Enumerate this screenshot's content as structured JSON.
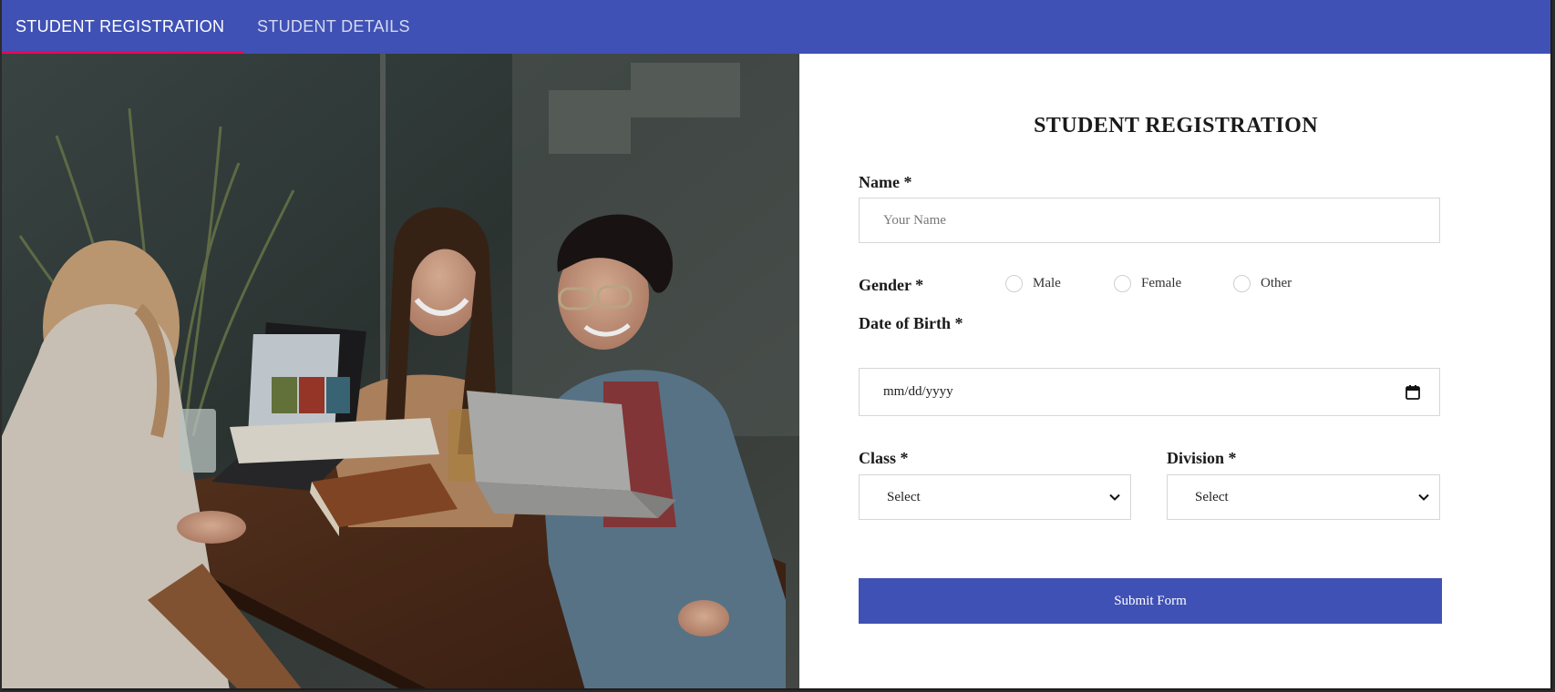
{
  "tabs": [
    {
      "label": "STUDENT REGISTRATION",
      "active": true
    },
    {
      "label": "STUDENT DETAILS",
      "active": false
    }
  ],
  "colors": {
    "accent": "#3f51b5",
    "tab_indicator": "#f50057"
  },
  "hero_image": {
    "icon": "photo-students-with-laptops"
  },
  "form": {
    "title": "STUDENT REGISTRATION",
    "name": {
      "label": "Name *",
      "placeholder": "Your Name",
      "value": ""
    },
    "gender": {
      "label": "Gender *",
      "options": [
        "Male",
        "Female",
        "Other"
      ]
    },
    "dob": {
      "label": "Date of Birth *",
      "value": "mm/dd/yyyy",
      "icon": "calendar-icon"
    },
    "class": {
      "label": "Class *",
      "value": "Select"
    },
    "division": {
      "label": "Division *",
      "value": "Select"
    },
    "submit_label": "Submit Form"
  }
}
